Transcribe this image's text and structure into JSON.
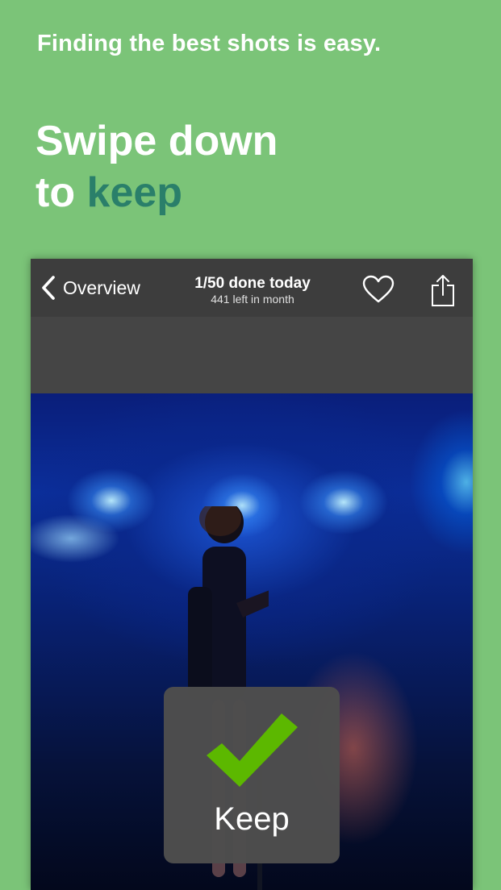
{
  "promo": {
    "tagline": "Finding the best shots is easy.",
    "headline_line1": "Swipe down",
    "headline_to": "to",
    "headline_keyword": "keep"
  },
  "navbar": {
    "back_label": "Overview",
    "title": "1/50 done today",
    "subtitle": "441 left in month",
    "icons": [
      "chevron-left-icon",
      "heart-icon",
      "share-icon"
    ]
  },
  "overlay": {
    "icon": "checkmark-icon",
    "label": "Keep"
  },
  "colors": {
    "background": "#7bc478",
    "accent": "#2a7f6a",
    "navbar": "#3d3d3d",
    "checkmark": "#5cb800"
  }
}
